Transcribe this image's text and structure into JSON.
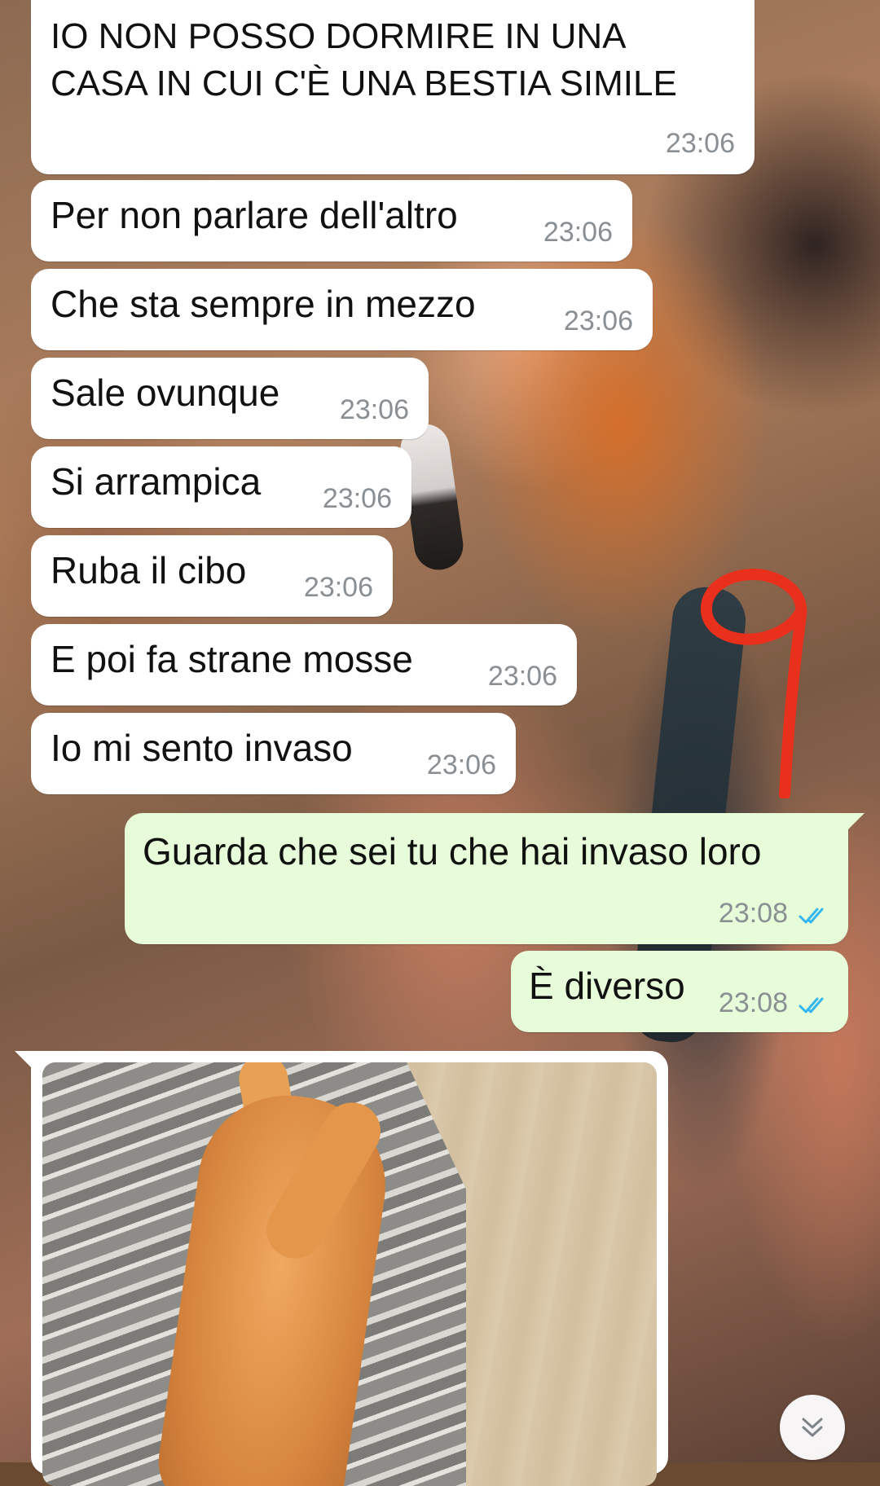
{
  "messages": [
    {
      "text": "IO NON POSSO DORMIRE IN UNA\nCASA IN CUI C'È UNA BESTIA SIMILE",
      "time": "23:06",
      "direction": "incoming"
    },
    {
      "text": "Per non parlare dell'altro",
      "time": "23:06",
      "direction": "incoming"
    },
    {
      "text": "Che sta sempre in mezzo",
      "time": "23:06",
      "direction": "incoming"
    },
    {
      "text": "Sale ovunque",
      "time": "23:06",
      "direction": "incoming"
    },
    {
      "text": "Si arrampica",
      "time": "23:06",
      "direction": "incoming"
    },
    {
      "text": "Ruba il cibo",
      "time": "23:06",
      "direction": "incoming"
    },
    {
      "text": "E poi fa strane mosse",
      "time": "23:06",
      "direction": "incoming"
    },
    {
      "text": "Io mi sento invaso",
      "time": "23:06",
      "direction": "incoming"
    },
    {
      "text": "Guarda che sei tu che hai invaso loro",
      "time": "23:08",
      "direction": "outgoing",
      "status": "read"
    },
    {
      "text": "È diverso",
      "time": "23:08",
      "direction": "outgoing",
      "status": "read"
    }
  ],
  "photo_message": {
    "direction": "incoming",
    "content": "photo of an orange tabby cat lying on a striped blanket"
  },
  "icons": {
    "read_receipt": "double-check-icon",
    "scroll_down": "chevron-double-down-icon"
  },
  "colors": {
    "incoming_bubble": "#ffffff",
    "outgoing_bubble": "#e7fcd9",
    "read_ticks": "#34b7f1",
    "time_text": "#8a8f93",
    "annotation_mark": "#e8301c"
  }
}
